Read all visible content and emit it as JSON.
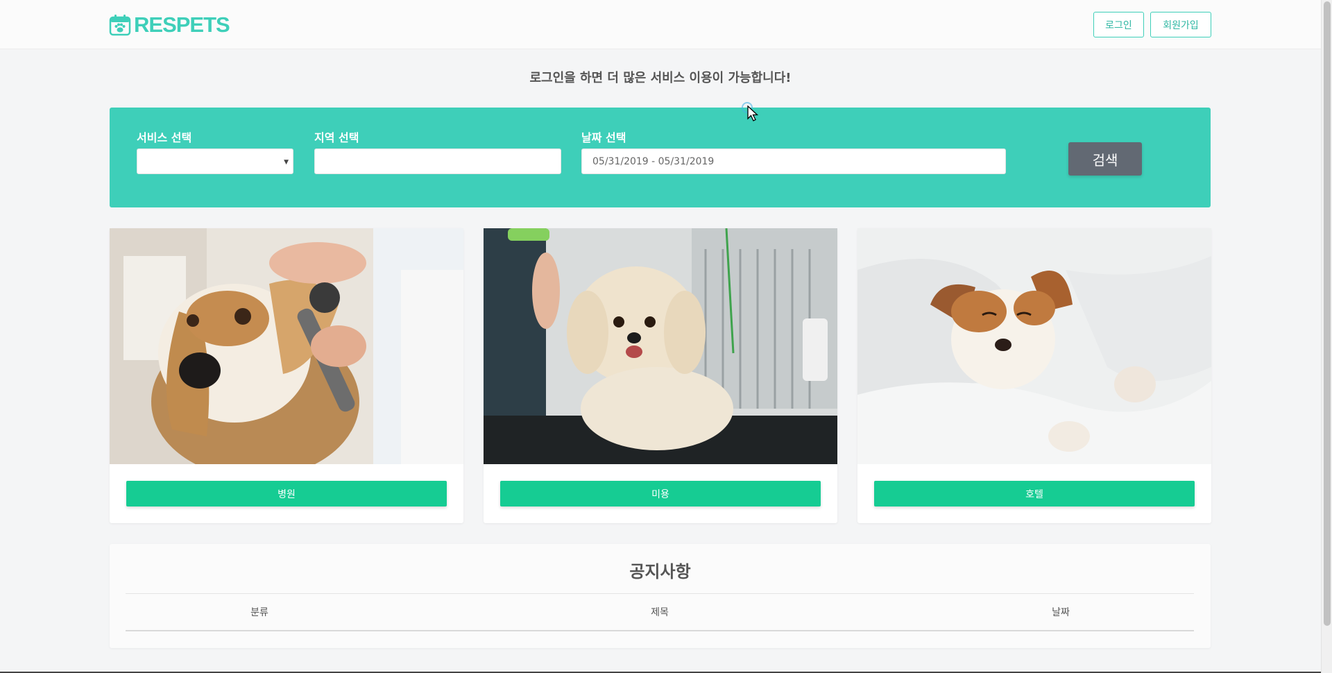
{
  "header": {
    "logo_text": "RESPETS",
    "login_label": "로그인",
    "join_label": "회원가입"
  },
  "notice_message": "로그인을 하면 더 많은 서비스 이용이 가능합니다!",
  "search": {
    "service_label": "서비스 선택",
    "service_value": "",
    "region_label": "지역 선택",
    "region_value": "",
    "date_label": "날짜 선택",
    "date_value": "05/31/2019 - 05/31/2019",
    "search_button": "검색"
  },
  "cards": [
    {
      "label": "병원",
      "image": "beagle-ear-exam-photo"
    },
    {
      "label": "미용",
      "image": "poodle-grooming-photo"
    },
    {
      "label": "호텔",
      "image": "dog-in-bed-photo"
    }
  ],
  "notices": {
    "title": "공지사항",
    "columns": [
      "분류",
      "제목",
      "날짜"
    ],
    "rows": []
  },
  "colors": {
    "brand": "#3ecfb9",
    "card_button": "#16cc93",
    "search_button": "#626973"
  }
}
